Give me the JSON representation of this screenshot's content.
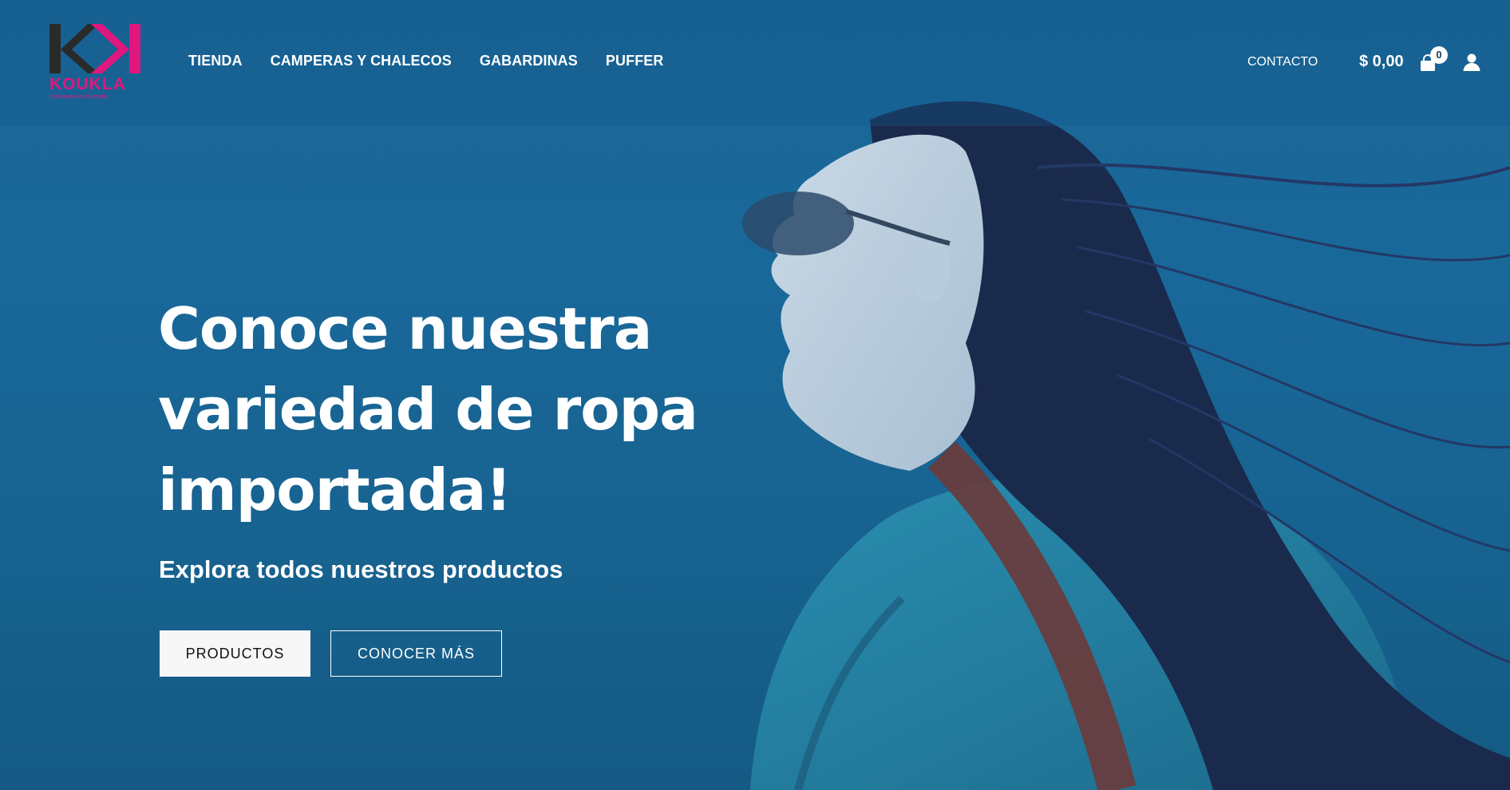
{
  "brand": {
    "logo_text": "KOUKLA",
    "tagline": "indumentaria importada",
    "colors": {
      "pink": "#e0177f",
      "dark": "#2a2a2a"
    }
  },
  "nav": {
    "items": [
      {
        "label": "TIENDA"
      },
      {
        "label": "CAMPERAS Y CHALECOS"
      },
      {
        "label": "GABARDINAS"
      },
      {
        "label": "PUFFER"
      }
    ],
    "contact_label": "CONTACTO"
  },
  "cart": {
    "total": "$ 0,00",
    "count": "0",
    "icon": "shopping-bag-icon"
  },
  "account": {
    "icon": "user-icon"
  },
  "hero": {
    "title": "Conoce nuestra variedad de ropa importada!",
    "subtitle": "Explora todos nuestros productos",
    "primary_button": "PRODUCTOS",
    "secondary_button": "CONOCER MÁS"
  },
  "theme": {
    "background": "#19689a",
    "text": "#ffffff"
  }
}
